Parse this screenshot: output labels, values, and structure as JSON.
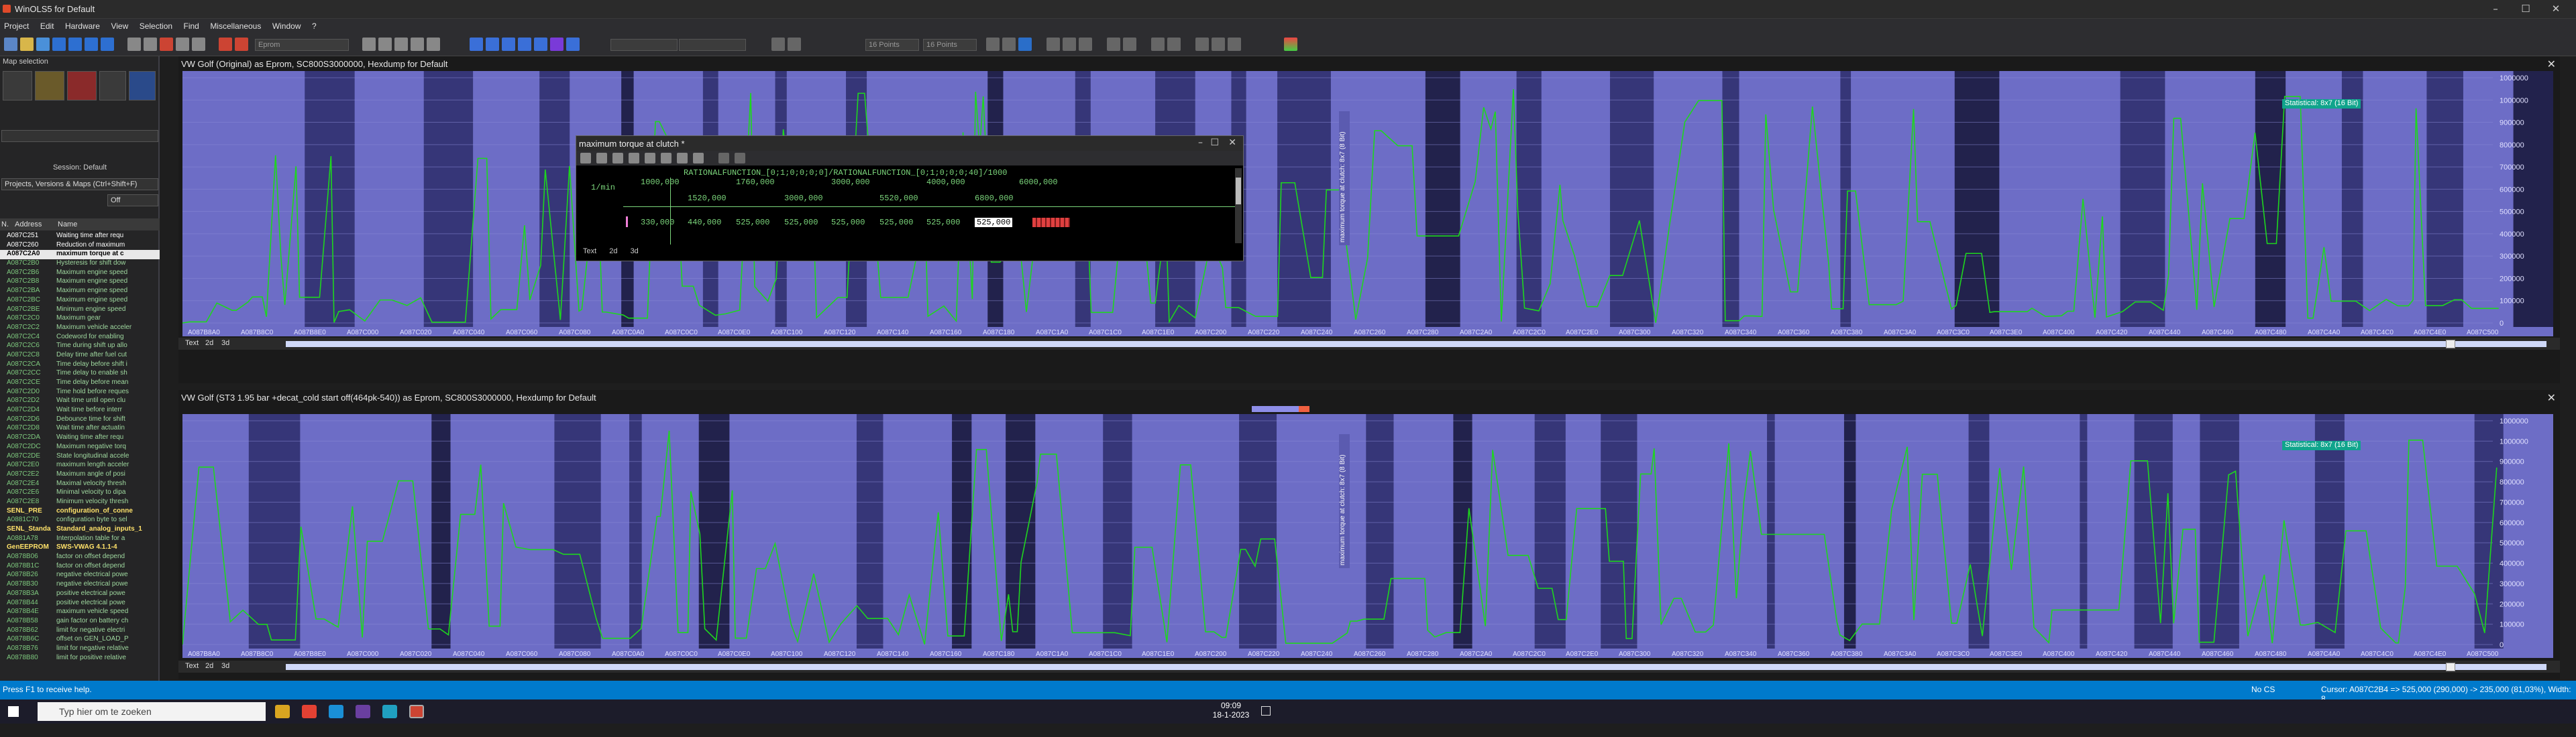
{
  "window": {
    "title": "WinOLS5 for Default"
  },
  "menu": [
    "Project",
    "Edit",
    "Hardware",
    "View",
    "Selection",
    "Find",
    "Miscellaneous",
    "Window",
    "?"
  ],
  "toolbar": {
    "field_placeholder": "Eprom",
    "step1": "16 Points",
    "step2": "16 Points"
  },
  "left": {
    "title": "Map selection",
    "session": "Session: Default",
    "filter": "Projects, Versions & Maps  (Ctrl+Shift+F)",
    "off": "Off",
    "col_no": "N.",
    "col_addr": "Address",
    "col_name": "Name",
    "rows": [
      {
        "a": "A087C251",
        "n": "Waiting time after requ",
        "c": "wh"
      },
      {
        "a": "A087C260",
        "n": "Reduction of maximum",
        "c": "wh"
      },
      {
        "a": "A087C2A0",
        "n": "maximum torque at c",
        "c": "sel"
      },
      {
        "a": "A087C2B0",
        "n": "Hysteresis for shift dow"
      },
      {
        "a": "A087C2B6",
        "n": "Maximum engine speed"
      },
      {
        "a": "A087C2B8",
        "n": "Maximum engine speed"
      },
      {
        "a": "A087C2BA",
        "n": "Maximum engine speed"
      },
      {
        "a": "A087C2BC",
        "n": "Maximum engine speed"
      },
      {
        "a": "A087C2BE",
        "n": "Minimum engine speed"
      },
      {
        "a": "A087C2C0",
        "n": "Maximum gear"
      },
      {
        "a": "A087C2C2",
        "n": "Maximum vehicle acceler"
      },
      {
        "a": "A087C2C4",
        "n": "Codeword for enabling"
      },
      {
        "a": "A087C2C6",
        "n": "Time during shift up allo"
      },
      {
        "a": "A087C2C8",
        "n": "Delay time after fuel cut"
      },
      {
        "a": "A087C2CA",
        "n": "Time delay before shift i"
      },
      {
        "a": "A087C2CC",
        "n": "Time delay to enable sh"
      },
      {
        "a": "A087C2CE",
        "n": "Time delay before mean"
      },
      {
        "a": "A087C2D0",
        "n": "Time hold before reques"
      },
      {
        "a": "A087C2D2",
        "n": "Wait time until open clu"
      },
      {
        "a": "A087C2D4",
        "n": "Wait time before interr"
      },
      {
        "a": "A087C2D6",
        "n": "Debounce time for shift"
      },
      {
        "a": "A087C2D8",
        "n": "Wait time after actuatin"
      },
      {
        "a": "A087C2DA",
        "n": "Waiting time after requ"
      },
      {
        "a": "A087C2DC",
        "n": "Maximum negative torq"
      },
      {
        "a": "A087C2DE",
        "n": "State longitudinal accele"
      },
      {
        "a": "A087C2E0",
        "n": "maximum length acceler"
      },
      {
        "a": "A087C2E2",
        "n": "Maximum angle of posi"
      },
      {
        "a": "A087C2E4",
        "n": "Maximal velocity thresh"
      },
      {
        "a": "A087C2E6",
        "n": "Minimal velocity to dipa"
      },
      {
        "a": "A087C2E8",
        "n": "Minimum velocity thresh"
      },
      {
        "a": "SENL_PRE",
        "n": "configuration_of_conne",
        "c": "hd"
      },
      {
        "a": "A0881C70",
        "n": "configuration byte to sel"
      },
      {
        "a": "SENL_Standa",
        "n": "Standard_analog_inputs_1",
        "c": "hd"
      },
      {
        "a": "A0881A78",
        "n": "Interpolation table for a"
      },
      {
        "a": "GenEEPROM",
        "n": "SWS-VWAG 4.1.1-4",
        "c": "hd"
      },
      {
        "a": "A0878B06",
        "n": "factor on offset depend"
      },
      {
        "a": "A0878B1C",
        "n": "factor on offset depend"
      },
      {
        "a": "A0878B26",
        "n": "negative electrical powe"
      },
      {
        "a": "A0878B30",
        "n": "negative electrical powe"
      },
      {
        "a": "A0878B3A",
        "n": "positive electrical powe"
      },
      {
        "a": "A0878B44",
        "n": "positive electrical powe"
      },
      {
        "a": "A0878B4E",
        "n": "maximum vehicle speed"
      },
      {
        "a": "A0878B58",
        "n": "gain factor on battery ch"
      },
      {
        "a": "A0878B62",
        "n": "limit for negative electri"
      },
      {
        "a": "A0878B6C",
        "n": "offset on GEN_LOAD_P"
      },
      {
        "a": "A0878B76",
        "n": "limit for negative relative"
      },
      {
        "a": "A0878B80",
        "n": "limit for positive relative"
      }
    ]
  },
  "pane1": {
    "title": "VW Golf (Original) as Eprom, SC800S3000000, Hexdump for Default",
    "stat": "Statistical: 8x7 (16 Bit)",
    "vlabel": "maximum torque at clutch: 8x7 (8 Bit)"
  },
  "pane2": {
    "title": "VW Golf (ST3 1.95 bar +decat_cold start off(464pk-540)) as Eprom, SC800S3000000, Hexdump for Default",
    "stat": "Statistical: 8x7 (16 Bit)",
    "vlabel": "maximum torque at clutch: 8x7 (8 Bit)"
  },
  "modes": {
    "text": "Text",
    "d2": "2d",
    "d3": "3d"
  },
  "xaxis": [
    "A087B8A0",
    "A087B8C0",
    "A087B8E0",
    "A087C000",
    "A087C020",
    "A087C040",
    "A087C060",
    "A087C080",
    "A087C0A0",
    "A087C0C0",
    "A087C0E0",
    "A087C100",
    "A087C120",
    "A087C140",
    "A087C160",
    "A087C180",
    "A087C1A0",
    "A087C1C0",
    "A087C1E0",
    "A087C200",
    "A087C220",
    "A087C240",
    "A087C260",
    "A087C280",
    "A087C2A0",
    "A087C2C0",
    "A087C2E0",
    "A087C300",
    "A087C320",
    "A087C340",
    "A087C360",
    "A087C380",
    "A087C3A0",
    "A087C3C0",
    "A087C3E0",
    "A087C400",
    "A087C420",
    "A087C440",
    "A087C460",
    "A087C480",
    "A087C4A0",
    "A087C4C0",
    "A087C4E0",
    "A087C500"
  ],
  "yaxis": [
    "1000000",
    "1000000",
    "900000",
    "800000",
    "700000",
    "600000",
    "500000",
    "400000",
    "300000",
    "200000",
    "100000",
    "0"
  ],
  "popup": {
    "title": "maximum torque at clutch *",
    "formula": "RATIONALFUNCTION_[0;1;0;0;0;0]/RATIONALFUNCTION_[0;1;0;0;0;40]/1000",
    "unit": "1/min",
    "axis_top": [
      "1000,000",
      "1760,000",
      "3000,000",
      "4000,000",
      "6000,000"
    ],
    "axis_bottom": [
      "1520,000",
      "3000,000",
      "5520,000",
      "6800,000"
    ],
    "values": [
      "330,000",
      "440,000",
      "525,000",
      "525,000",
      "525,000",
      "525,000",
      "525,000"
    ],
    "selected": "525,000",
    "tabs": [
      "Text",
      "2d",
      "3d"
    ]
  },
  "status": {
    "left": "Press F1 to receive help.",
    "cs": "No CS",
    "cursor": "Cursor: A087C2B4 => 525,000 (290,000) -> 235,000 (81,03%), Width: 8"
  },
  "taskbar": {
    "search": "Typ hier om te zoeken",
    "time": "09:09",
    "date": "18-1-2023"
  },
  "colors": {
    "plot_bg": "#6d6dc6",
    "line": "#1ed61e",
    "dark": "#24245a",
    "accent": "#007acc"
  }
}
